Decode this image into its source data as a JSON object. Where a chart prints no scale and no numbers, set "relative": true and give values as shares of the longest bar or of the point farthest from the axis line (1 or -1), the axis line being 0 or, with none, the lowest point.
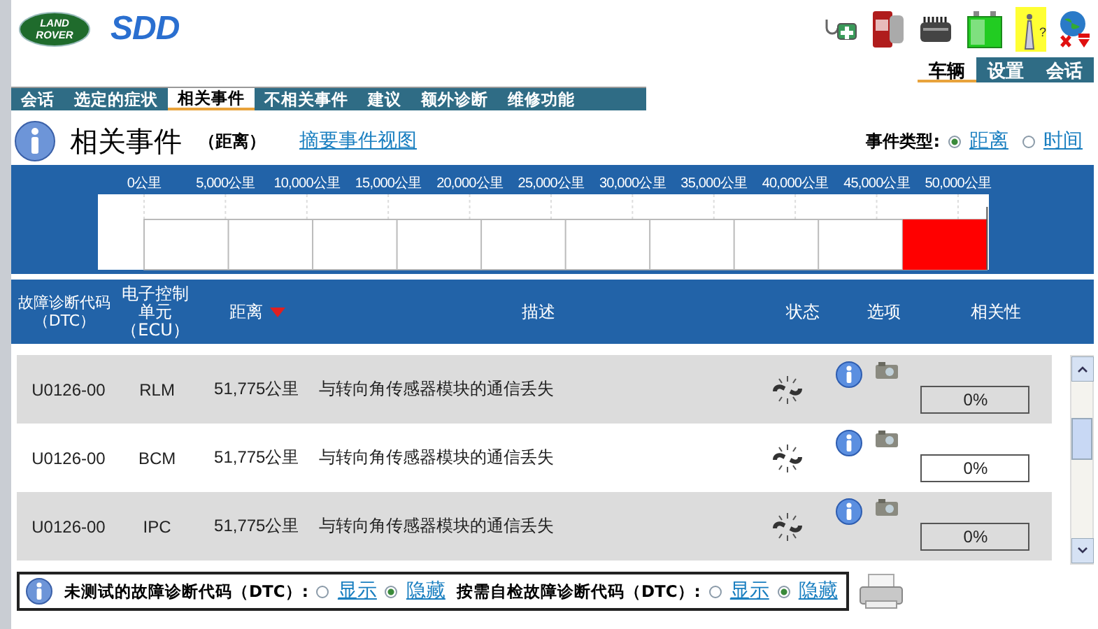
{
  "logo": {
    "line_1": "LAND",
    "line_2": "ROVER",
    "product": "SDD"
  },
  "toolbar": {
    "antenna_mark": "?"
  },
  "top_tabs": [
    {
      "label": "车辆",
      "selected": true
    },
    {
      "label": "设置",
      "selected": false
    },
    {
      "label": "会话",
      "selected": false
    }
  ],
  "tabs": [
    {
      "label": "会话",
      "selected": false
    },
    {
      "label": "选定的症状",
      "selected": false
    },
    {
      "label": "相关事件",
      "selected": true
    },
    {
      "label": "不相关事件",
      "selected": false
    },
    {
      "label": "建议",
      "selected": false
    },
    {
      "label": "额外诊断",
      "selected": false
    },
    {
      "label": "维修功能",
      "selected": false
    }
  ],
  "page": {
    "title": "相关事件",
    "subtitle": "（距离）",
    "summary_link": "摘要事件视图",
    "event_type_label": "事件类型:",
    "event_types": [
      {
        "label": "距离",
        "selected": true
      },
      {
        "label": "时间",
        "selected": false
      }
    ]
  },
  "chart": {
    "chart_data": {
      "type": "bar",
      "x": [
        49190
      ],
      "values": [
        1
      ],
      "relative": true,
      "grid": true,
      "xlim": [
        0,
        51775
      ],
      "xticks": [
        {
          "value": 0,
          "label": "0公里"
        },
        {
          "value": 5000,
          "label": "5,000公里"
        },
        {
          "value": 10000,
          "label": "10,000公里"
        },
        {
          "value": 15000,
          "label": "15,000公里"
        },
        {
          "value": 20000,
          "label": "20,000公里"
        },
        {
          "value": 25000,
          "label": "25,000公里"
        },
        {
          "value": 30000,
          "label": "30,000公里"
        },
        {
          "value": 35000,
          "label": "35,000公里"
        },
        {
          "value": 40000,
          "label": "40,000公里"
        },
        {
          "value": 45000,
          "label": "45,000公里"
        },
        {
          "value": 50000,
          "label": "50,000公里"
        }
      ]
    }
  },
  "table": {
    "columns": [
      "故障诊断代码（DTC）",
      "电子控制单元（ECU）",
      "距离",
      "描述",
      "状态",
      "选项",
      "相关性"
    ],
    "rows": [
      {
        "dtc": "U0126-00",
        "ecu": "RLM",
        "distance": "51,775公里",
        "description": "与转向角传感器模块的通信丢失",
        "relevance": "0%",
        "level": 0
      },
      {
        "dtc": "U0126-00",
        "ecu": "BCM",
        "distance": "51,775公里",
        "description": "与转向角传感器模块的通信丢失",
        "relevance": "0%",
        "level": 0
      },
      {
        "dtc": "U0126-00",
        "ecu": "IPC",
        "distance": "51,775公里",
        "description": "与转向角传感器模块的通信丢失",
        "relevance": "0%",
        "level": 0
      }
    ]
  },
  "footer": {
    "groups": [
      {
        "label": "未测试的故障诊断代码（DTC）:",
        "options": [
          {
            "label": "显示",
            "selected": false
          },
          {
            "label": "隐藏",
            "selected": true
          }
        ]
      },
      {
        "label": "按需自检故障诊断代码（DTC）:",
        "options": [
          {
            "label": "显示",
            "selected": false
          },
          {
            "label": "隐藏",
            "selected": true
          }
        ]
      }
    ]
  }
}
